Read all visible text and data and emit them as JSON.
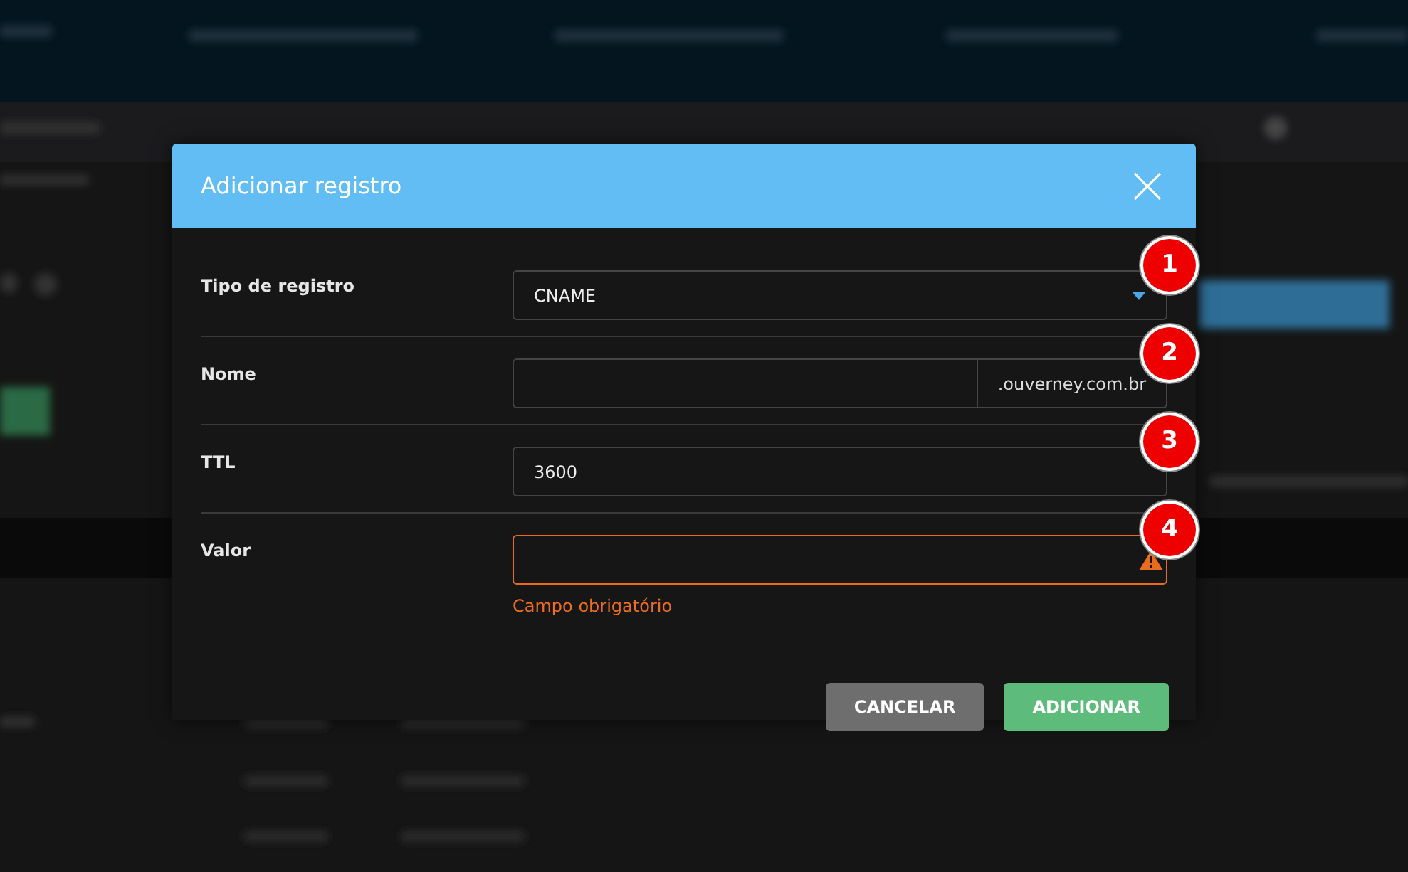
{
  "dialog": {
    "title": "Adicionar registro"
  },
  "fields": [
    {
      "label": "Tipo de registro",
      "kind": "select",
      "value": "CNAME",
      "invalid": false,
      "badge": "1"
    },
    {
      "label": "Nome",
      "kind": "suffix",
      "suffix": ".ouverney.com.br",
      "invalid": false,
      "badge": "2"
    },
    {
      "label": "TTL",
      "kind": "text",
      "value": "3600",
      "invalid": false,
      "badge": "3"
    },
    {
      "label": "Valor",
      "kind": "text",
      "invalid": true,
      "error": "Campo obrigatório",
      "badge": "4"
    }
  ],
  "buttons": [
    {
      "label": "CANCELAR",
      "kind": "secondary"
    },
    {
      "label": "ADICIONAR",
      "kind": "primary"
    }
  ]
}
